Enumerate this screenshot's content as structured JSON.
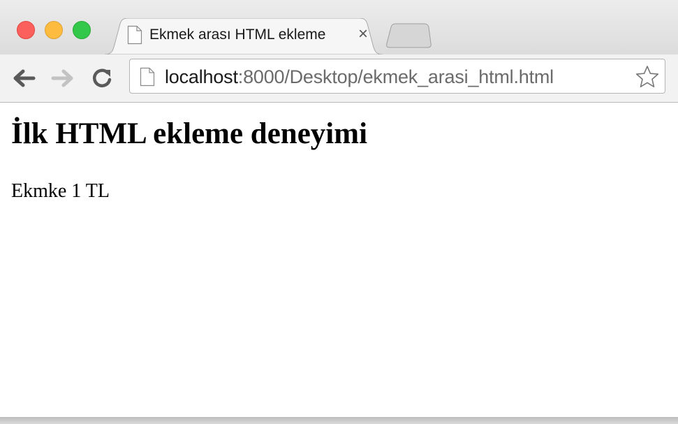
{
  "window": {
    "controls": [
      "close",
      "minimize",
      "maximize"
    ],
    "colors": {
      "close": "#fc605c",
      "minimize": "#fdbc40",
      "maximize": "#34c84a"
    }
  },
  "tabs": [
    {
      "title": "Ekmek arası HTML ekleme",
      "icon": "page-icon",
      "close_label": "×",
      "active": true
    }
  ],
  "toolbar": {
    "back_icon": "arrow-left-icon",
    "forward_icon": "arrow-right-icon",
    "reload_icon": "reload-icon",
    "bookmark_icon": "star-icon"
  },
  "address_bar": {
    "host": "localhost",
    "path": ":8000/Desktop/ekmek_arasi_html.html"
  },
  "page": {
    "heading": "İlk HTML ekleme deneyimi",
    "paragraph": "Ekmke 1 TL"
  }
}
